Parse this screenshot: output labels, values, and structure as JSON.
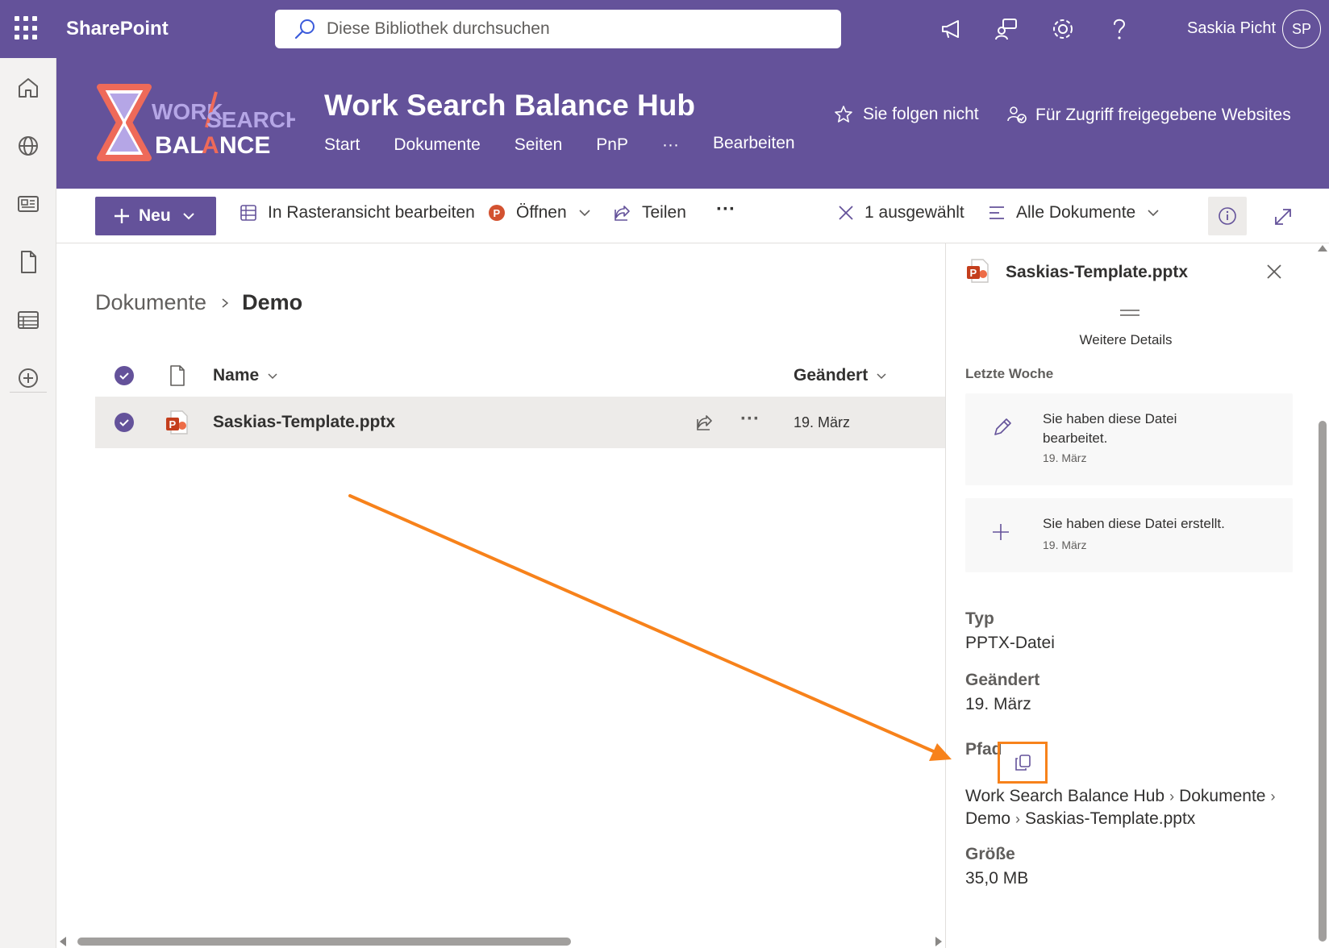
{
  "suitebar": {
    "brand": "SharePoint",
    "search_placeholder": "Diese Bibliothek durchsuchen",
    "user_name": "Saskia Picht",
    "user_initials": "SP"
  },
  "site": {
    "logo_text": "WORK SEARCH BALANCE",
    "title": "Work Search Balance Hub",
    "nav": [
      "Start",
      "Dokumente",
      "Seiten",
      "PnP",
      "···",
      "Bearbeiten"
    ],
    "follow_label": "Sie folgen nicht",
    "shared_sites_label": "Für Zugriff freigegebene Websites"
  },
  "commandbar": {
    "new_label": "Neu",
    "grid_edit_label": "In Rasteransicht bearbeiten",
    "open_label": "Öffnen",
    "share_label": "Teilen",
    "more_label": "···",
    "selected_label": "1 ausgewählt",
    "view_label": "Alle Dokumente"
  },
  "breadcrumb": {
    "parent": "Dokumente",
    "current": "Demo"
  },
  "list": {
    "col_name": "Name",
    "col_modified": "Geändert",
    "rows": [
      {
        "name": "Saskias-Template.pptx",
        "modified": "19. März",
        "more": "···"
      }
    ]
  },
  "details": {
    "file_name": "Saskias-Template.pptx",
    "more_details": "Weitere Details",
    "recent_heading": "Letzte Woche",
    "activities": [
      {
        "text": "Sie haben diese Datei bearbeitet.",
        "date": "19. März"
      },
      {
        "text": "Sie haben diese Datei erstellt.",
        "date": "19. März"
      }
    ],
    "type_label": "Typ",
    "type_value": "PPTX-Datei",
    "modified_label": "Geändert",
    "modified_value": "19. März",
    "path_label": "Pfad",
    "path_segments": [
      "Work Search Balance Hub",
      "Dokumente",
      "Demo",
      "Saskias-Template.pptx"
    ],
    "size_label": "Größe",
    "size_value": "35,0 MB"
  },
  "colors": {
    "theme": "#64529a",
    "annotation": "#f7821b",
    "selected_row": "#edebe9"
  }
}
